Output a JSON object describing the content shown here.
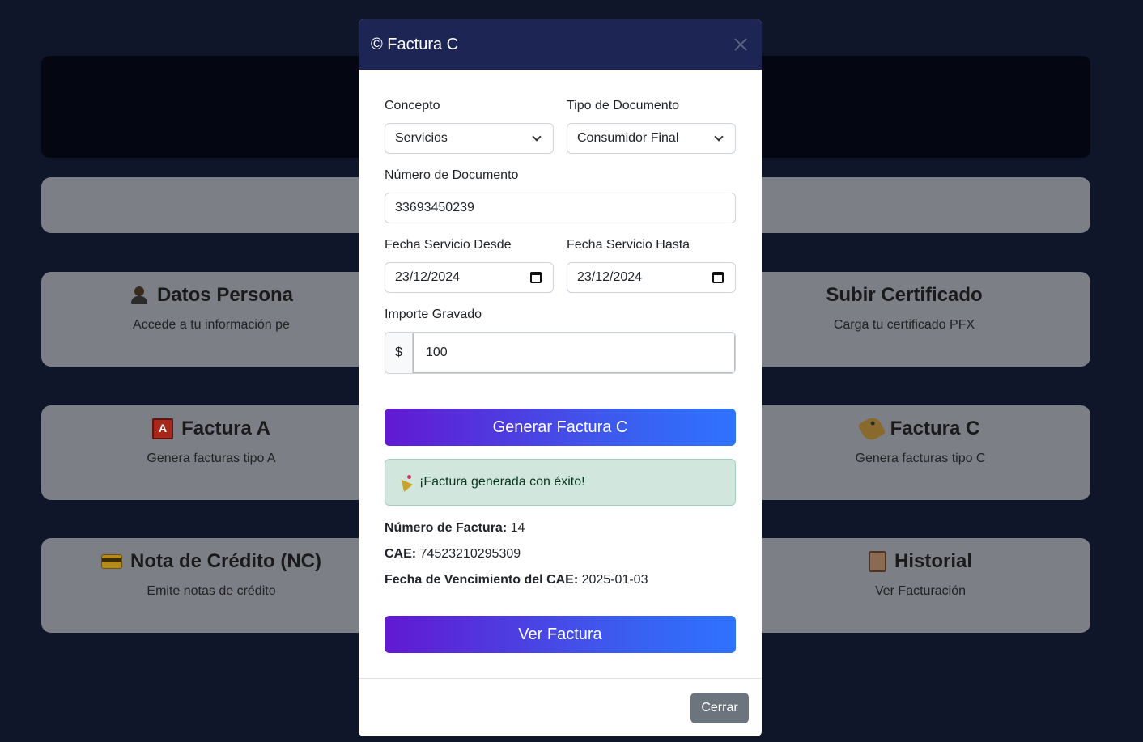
{
  "background": {
    "cards": [
      {
        "left_title": "Datos Persona",
        "left_desc": "Accede a tu información pe",
        "right_title": "Subir Certificado",
        "right_desc": "Carga tu certificado PFX"
      },
      {
        "left_title": "Factura A",
        "left_desc": "Genera facturas tipo A",
        "right_title": "Factura C",
        "right_desc": "Genera facturas tipo C"
      },
      {
        "left_title": "Nota de Crédito (NC)",
        "left_desc": "Emite notas de crédito",
        "right_title": "Historial",
        "right_desc": "Ver Facturación"
      }
    ]
  },
  "modal": {
    "title": "© Factura C",
    "concepto": {
      "label": "Concepto",
      "value": "Servicios"
    },
    "tipo_documento": {
      "label": "Tipo de Documento",
      "value": "Consumidor Final"
    },
    "numero_documento": {
      "label": "Número de Documento",
      "value": "33693450239"
    },
    "fecha_desde": {
      "label": "Fecha Servicio Desde",
      "value": "23/12/2024"
    },
    "fecha_hasta": {
      "label": "Fecha Servicio Hasta",
      "value": "23/12/2024"
    },
    "importe": {
      "label": "Importe Gravado",
      "prefix": "$",
      "value": "100"
    },
    "generate_button": "Generar Factura C",
    "success_message": "¡Factura generada con éxito!",
    "result": {
      "numero_label": "Número de Factura:",
      "numero_value": "14",
      "cae_label": "CAE:",
      "cae_value": "74523210295309",
      "vto_label": "Fecha de Vencimiento del CAE:",
      "vto_value": "2025-01-03"
    },
    "view_button": "Ver Factura",
    "close_button": "Cerrar"
  },
  "colors": {
    "page_bg": "#0f1629",
    "header_bg": "#1c2554",
    "gradient_start": "#6219d1",
    "gradient_end": "#2e73ff",
    "success_bg": "#d1e7dd",
    "secondary_btn": "#6c757d"
  }
}
